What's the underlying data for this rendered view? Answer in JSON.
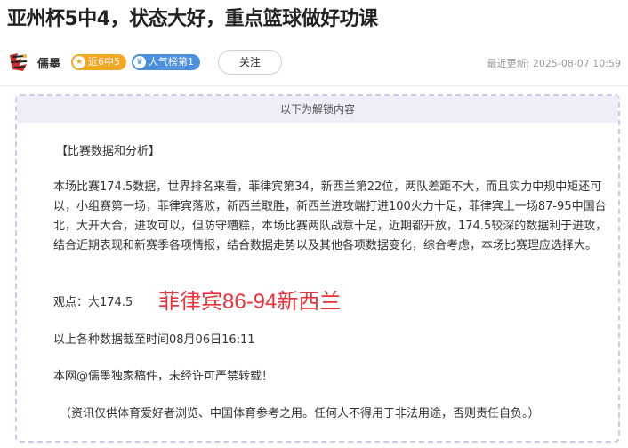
{
  "article": {
    "title": "亚州杯5中4，状态大好，重点篮球做好功课"
  },
  "author": {
    "name": "儒墨",
    "avatar_icon": "author-logo",
    "badges": [
      {
        "label": "近6中5",
        "icon": "star-icon",
        "color": "#f5a623"
      },
      {
        "label": "人气榜第1",
        "icon": "crown-icon",
        "color": "#4b8fe0"
      }
    ],
    "follow_label": "关注",
    "update_label": "最近更新:",
    "update_time": "2025-08-07 10:59"
  },
  "unlock": {
    "header": "以下为解锁内容"
  },
  "content": {
    "section_title": "【比赛数据和分析】",
    "analysis": "本场比赛174.5数据，世界排名来看，菲律宾第34，新西兰第22位，两队差距不大，而且实力中规中矩还可以，小组赛第一场，菲律宾落败，新西兰取胜，新西兰进攻端打进100火力十足，菲律宾上一场87-95中国台北，大开大合，进攻可以，但防守糟糕，本场比赛两队战意十足，近期都开放，174.5较深的数据利于进攻，结合近期表现和新赛季各项情报，结合数据走势以及其他各项数据变化，综合考虑，本场比赛理应选择大。",
    "view_label": "观点：大174.5",
    "prediction": "菲律宾86-94新西兰",
    "prediction_color": "#e8333a",
    "cutoff": "以上各种数据截至时间08月06日16:11",
    "copyright": "本网@儒墨独家稿件，未经许可严禁转载！",
    "disclaimer": "（资讯仅供体育爱好者浏览、中国体育参考之用。任何人不得用于非法用途，否则责任自负。）"
  }
}
